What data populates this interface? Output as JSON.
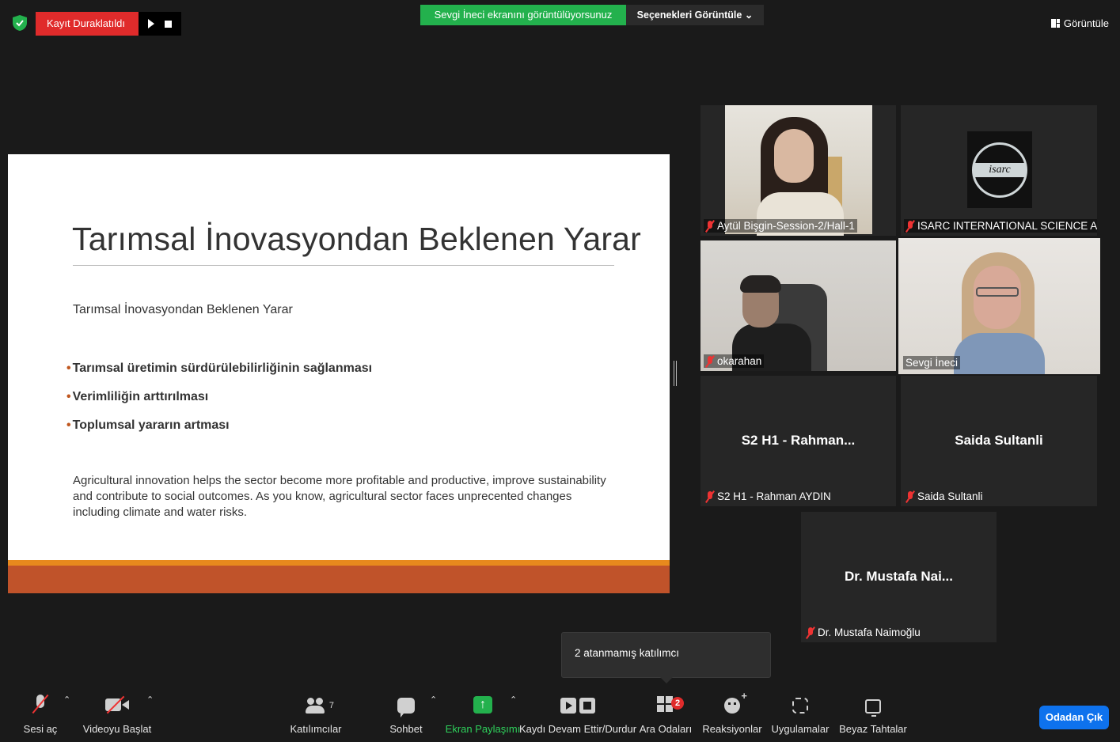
{
  "top_bar": {
    "recording_status": "Kayıt Duraklatıldı",
    "share_banner": "Sevgi İneci ekranını görüntülüyorsunuz",
    "view_options": "Seçenekleri Görüntüle ⌄",
    "view_button": "Görüntüle"
  },
  "slide": {
    "title": "Tarımsal İnovasyondan Beklenen Yarar",
    "subtitle": "Tarımsal İnovasyondan Beklenen Yarar",
    "bullets": [
      "Tarımsal üretimin sürdürülebilirliğinin sağlanması",
      "Verimliliğin arttırılması",
      "Toplumsal yararın artması"
    ],
    "paragraph": "Agricultural innovation helps the sector become more profitable and productive, improve sustainability and contribute to social outcomes. As you know, agricultural sector faces unprecented changes including climate and water risks."
  },
  "participants": [
    {
      "name": "Aytül Bişgin-Session-2/Hall-1",
      "muted": true,
      "video": true
    },
    {
      "name": "ISARC INTERNATIONAL SCIENCE A...",
      "muted": true,
      "video": true,
      "logo_text": "isarc"
    },
    {
      "name": "okarahan",
      "muted": true,
      "video": true
    },
    {
      "name": "Sevgi İneci",
      "muted": false,
      "video": true,
      "active_speaker": true
    },
    {
      "name": "S2 H1 - Rahman AYDIN",
      "display": "S2 H1 - Rahman...",
      "muted": true,
      "video": false
    },
    {
      "name": "Saida Sultanli",
      "display": "Saida Sultanli",
      "muted": true,
      "video": false
    },
    {
      "name": "Dr. Mustafa Naimoğlu",
      "display": "Dr. Mustafa Nai...",
      "muted": true,
      "video": false
    }
  ],
  "tooltip": "2 atanmamış katılımcı",
  "toolbar": {
    "audio": "Sesi aç",
    "video": "Videoyu Başlat",
    "participants": "Katılımcılar",
    "participant_count": "7",
    "chat": "Sohbet",
    "share": "Ekran Paylaşımı",
    "record": "Kaydı Devam Ettir/Durdur",
    "breakout": "Ara Odaları",
    "breakout_badge": "2",
    "reactions": "Reaksiyonlar",
    "apps": "Uygulamalar",
    "whiteboards": "Beyaz Tahtalar",
    "leave": "Odadan Çık"
  },
  "colors": {
    "recording_red": "#e02b2b",
    "share_green": "#23b14d",
    "active_speaker_outline": "#e4ef6b",
    "leave_blue": "#0e72ed",
    "slide_footer": "#c0532a"
  }
}
